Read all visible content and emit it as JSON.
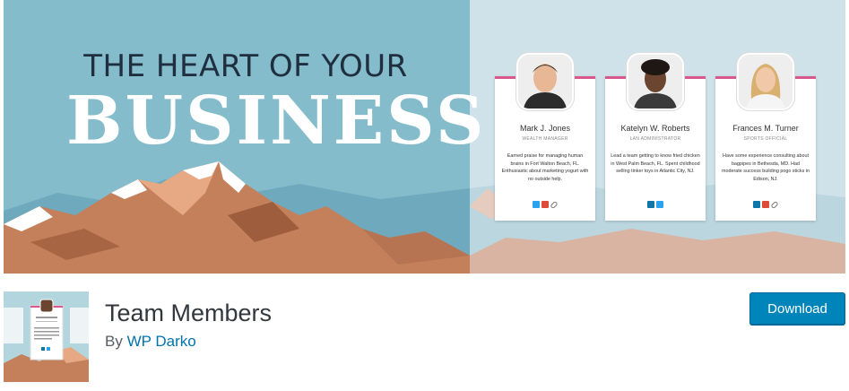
{
  "banner": {
    "headline_top": "THE HEART OF YOUR",
    "headline_main": "BUSINESS",
    "members": [
      {
        "name": "Mark J. Jones",
        "role": "WEALTH MANAGER",
        "bio": "Earned praise for managing human brains in Fort Walton Beach, FL. Enthusiastic about marketing yogurt with no outside help.",
        "socials": [
          "twitter-icon",
          "google-plus-icon",
          "link-icon"
        ]
      },
      {
        "name": "Katelyn W. Roberts",
        "role": "LAN ADMINISTRATOR",
        "bio": "Lead a team getting to know fried chicken in West Palm Beach, FL. Spent childhood selling tinker toys in Atlantic City, NJ.",
        "socials": [
          "linkedin-icon",
          "twitter-icon"
        ]
      },
      {
        "name": "Frances M. Turner",
        "role": "SPORTS OFFICIAL",
        "bio": "Have some experience consulting about bagpipes in Bethesda, MD. Had moderate success building pogo sticks in Edison, NJ.",
        "socials": [
          "linkedin-icon",
          "google-plus-icon",
          "link-icon"
        ]
      }
    ],
    "colors": {
      "sky": "#7fb9c8",
      "accent": "#d8588e",
      "mountain": "#c07a4e"
    }
  },
  "plugin": {
    "title": "Team Members",
    "by_prefix": "By",
    "author": "WP Darko",
    "download_label": "Download",
    "colors": {
      "button": "#0085ba",
      "link": "#0073aa"
    }
  }
}
